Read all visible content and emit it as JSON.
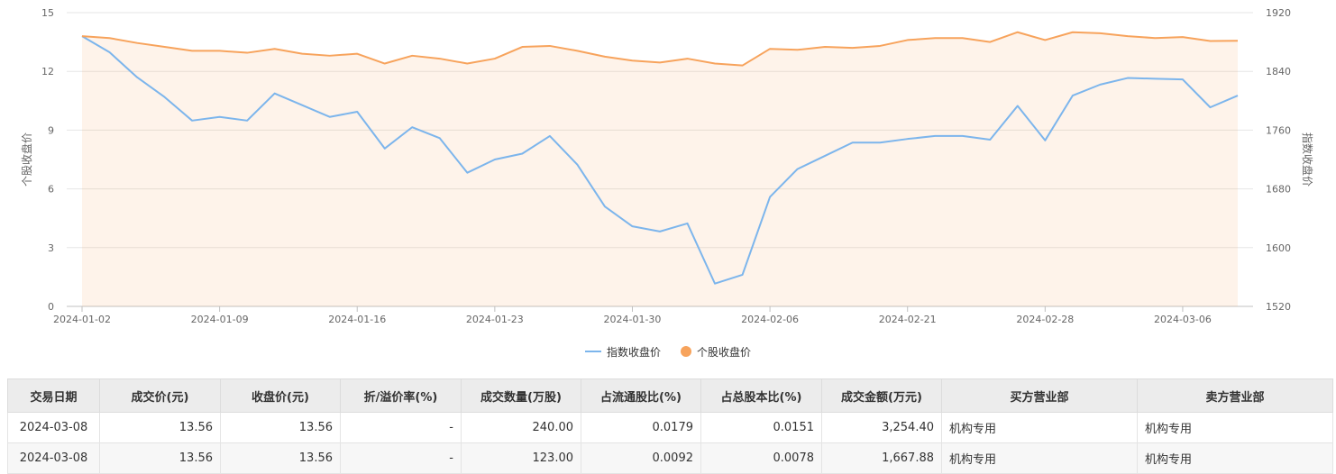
{
  "chart_data": {
    "type": "line",
    "x": [
      "2024-01-02",
      "2024-01-03",
      "2024-01-04",
      "2024-01-05",
      "2024-01-08",
      "2024-01-09",
      "2024-01-10",
      "2024-01-11",
      "2024-01-12",
      "2024-01-15",
      "2024-01-16",
      "2024-01-17",
      "2024-01-18",
      "2024-01-19",
      "2024-01-22",
      "2024-01-23",
      "2024-01-24",
      "2024-01-25",
      "2024-01-26",
      "2024-01-29",
      "2024-01-30",
      "2024-01-31",
      "2024-02-01",
      "2024-02-02",
      "2024-02-05",
      "2024-02-06",
      "2024-02-07",
      "2024-02-08",
      "2024-02-19",
      "2024-02-20",
      "2024-02-21",
      "2024-02-22",
      "2024-02-23",
      "2024-02-26",
      "2024-02-27",
      "2024-02-28",
      "2024-02-29",
      "2024-03-01",
      "2024-03-04",
      "2024-03-05",
      "2024-03-06",
      "2024-03-07",
      "2024-03-08"
    ],
    "x_ticks": [
      "2024-01-02",
      "2024-01-09",
      "2024-01-16",
      "2024-01-23",
      "2024-01-30",
      "2024-02-06",
      "2024-02-21",
      "2024-02-28",
      "2024-03-06"
    ],
    "left_axis": {
      "label": "个股收盘价",
      "min": 0,
      "max": 15,
      "ticks": [
        0,
        3,
        6,
        9,
        12,
        15
      ]
    },
    "right_axis": {
      "label": "指数收盘价",
      "min": 1520,
      "max": 1920,
      "ticks": [
        1520,
        1600,
        1680,
        1760,
        1840,
        1920
      ]
    },
    "series": [
      {
        "name": "指数收盘价",
        "axis": "right",
        "color": "#7cb5ec",
        "values": [
          1888,
          1866,
          1832,
          1805,
          1773,
          1778,
          1773,
          1810,
          1794,
          1778,
          1785,
          1735,
          1764,
          1749,
          1702,
          1720,
          1728,
          1752,
          1713,
          1656,
          1629,
          1622,
          1633,
          1551,
          1563,
          1669,
          1707,
          1725,
          1743,
          1743,
          1748,
          1752,
          1752,
          1747,
          1793,
          1746,
          1807,
          1822,
          1831,
          1830,
          1829,
          1791,
          1807
        ]
      },
      {
        "name": "个股收盘价",
        "axis": "left",
        "color": "#f7a35c",
        "values": [
          13.8,
          13.7,
          13.45,
          13.25,
          13.05,
          13.05,
          12.95,
          13.15,
          12.9,
          12.8,
          12.9,
          12.4,
          12.8,
          12.65,
          12.4,
          12.65,
          13.25,
          13.3,
          13.05,
          12.75,
          12.55,
          12.45,
          12.65,
          12.4,
          12.3,
          13.15,
          13.1,
          13.25,
          13.2,
          13.3,
          13.6,
          13.7,
          13.7,
          13.5,
          14.0,
          13.6,
          14.0,
          13.95,
          13.8,
          13.7,
          13.75,
          13.55,
          13.56
        ]
      }
    ],
    "legend_position": "bottom-center",
    "grid": true
  },
  "legend": {
    "index_label": "指数收盘价",
    "stock_label": "个股收盘价"
  },
  "table": {
    "headers": [
      "交易日期",
      "成交价(元)",
      "收盘价(元)",
      "折/溢价率(%)",
      "成交数量(万股)",
      "占流通股比(%)",
      "占总股本比(%)",
      "成交金额(万元)",
      "买方营业部",
      "卖方营业部"
    ],
    "rows": [
      [
        "2024-03-08",
        "13.56",
        "13.56",
        "-",
        "240.00",
        "0.0179",
        "0.0151",
        "3,254.40",
        "机构专用",
        "机构专用"
      ],
      [
        "2024-03-08",
        "13.56",
        "13.56",
        "-",
        "123.00",
        "0.0092",
        "0.0078",
        "1,667.88",
        "机构专用",
        "机构专用"
      ]
    ]
  }
}
